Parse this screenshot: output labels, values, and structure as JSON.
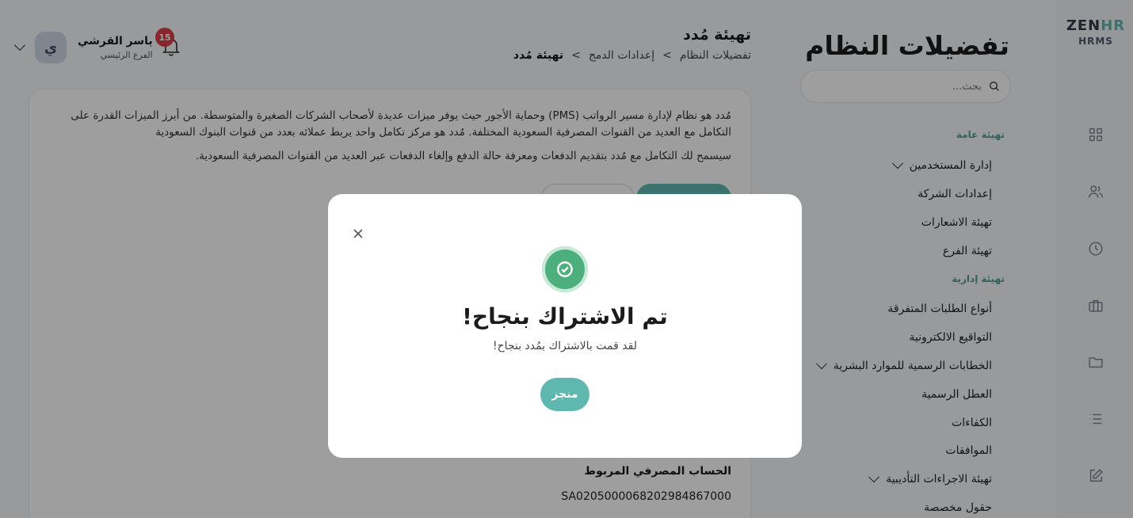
{
  "brand": {
    "logo_main": "ZEN",
    "logo_accent": "HR",
    "logo_sub": "HRMS"
  },
  "rail_icons": [
    "grid-icon",
    "users-icon",
    "clock-icon",
    "briefcase-icon",
    "folder-icon",
    "list-icon",
    "edit-icon"
  ],
  "settings": {
    "title": "تفضيلات النظام",
    "search_placeholder": "بحث...",
    "groups": [
      {
        "label": "تهيئة عامة"
      },
      {
        "label": "تهيئة إدارية"
      }
    ],
    "items": [
      {
        "label": "إدارة المستخدمين",
        "has_chevron": true
      },
      {
        "label": "إعدادات الشركة",
        "has_chevron": false
      },
      {
        "label": "تهيئة الاشعارات",
        "has_chevron": false
      },
      {
        "label": "تهيئة الفرع",
        "has_chevron": false
      },
      {
        "label": "أنواع الطلبات المتفرقة",
        "has_chevron": false
      },
      {
        "label": "التواقيع الالكترونية",
        "has_chevron": false
      },
      {
        "label": "الخطابات الرسمية للموارد البشرية",
        "has_chevron": true
      },
      {
        "label": "العطل الرسمية",
        "has_chevron": false
      },
      {
        "label": "الكفاءات",
        "has_chevron": false
      },
      {
        "label": "الموافقات",
        "has_chevron": false
      },
      {
        "label": "تهيئة الاجراءات التأديبية",
        "has_chevron": true
      },
      {
        "label": "حقول مخصصة",
        "has_chevron": false
      }
    ]
  },
  "header": {
    "page_title": "تهيئة مُدد",
    "breadcrumb": [
      "تفضيلات النظام",
      ">",
      "إعدادات الدمج",
      ">",
      "تهيئة مُدد"
    ],
    "user_name": "ياسر القرشي",
    "user_branch": "الفرع الرئيسي",
    "avatar_initial": "ي",
    "notification_count": "15"
  },
  "main": {
    "desc_line1": "مُدد هو نظام لإدارة مسير الرواتب (PMS) وحماية الأجور حيث يوفر ميزات عديدة لأصحاب الشركات الصغيرة والمتوسطة. من أبرز الميزات القدرة على التكامل مع العديد من القنوات المصرفية السعودية المختلفة. مُدد هو مركز تكامل واحد يربط عملائه بعدد من قنوات البنوك السعودية",
    "desc_line2": "سيسمح لك التكامل مع مُدد بتقديم الدفعات ومعرفة حالة الدفع وإلغاء الدفعات عبر العديد من القنوات المصرفية السعودية.",
    "linked_account_label": "الحساب المصرفي المربوط",
    "linked_account_value": "SA0205000068202984867000"
  },
  "modal": {
    "title": "تم الاشتراك بنجاح!",
    "message": "لقد قمت بالاشتراك بمُدد بنجاح!",
    "done_label": "منجز"
  },
  "colors": {
    "accent": "#5fb8b0",
    "success": "#4caf7d",
    "badge": "#d9404b"
  }
}
